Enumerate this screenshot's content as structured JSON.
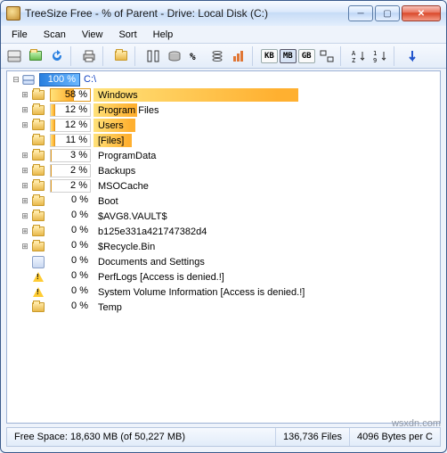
{
  "title": "TreeSize Free - % of Parent - Drive: Local Disk (C:)",
  "menus": [
    "File",
    "Scan",
    "View",
    "Sort",
    "Help"
  ],
  "toolbar": {
    "units": {
      "kb": "KB",
      "mb": "MB",
      "gb": "GB"
    }
  },
  "root": {
    "percent": "100 %",
    "path": "C:\\"
  },
  "rows": [
    {
      "pct": "58 %",
      "fill": 58,
      "name": "Windows",
      "ext": 230,
      "icon": "folder",
      "exp": "+"
    },
    {
      "pct": "12 %",
      "fill": 12,
      "name": "Program Files",
      "ext": 49,
      "icon": "folder",
      "exp": "+"
    },
    {
      "pct": "12 %",
      "fill": 12,
      "name": "Users",
      "ext": 47,
      "icon": "folder",
      "exp": "+"
    },
    {
      "pct": "11 %",
      "fill": 11,
      "name": "[Files]",
      "ext": 43,
      "icon": "folder",
      "exp": ""
    },
    {
      "pct": "3 %",
      "fill": 3,
      "name": "ProgramData",
      "ext": 0,
      "icon": "folder",
      "exp": "+"
    },
    {
      "pct": "2 %",
      "fill": 2,
      "name": "Backups",
      "ext": 0,
      "icon": "folder",
      "exp": "+"
    },
    {
      "pct": "2 %",
      "fill": 2,
      "name": "MSOCache",
      "ext": 0,
      "icon": "folder",
      "exp": "+"
    },
    {
      "pct": "0 %",
      "fill": 0,
      "name": "Boot",
      "ext": 0,
      "icon": "folder",
      "exp": "+"
    },
    {
      "pct": "0 %",
      "fill": 0,
      "name": "$AVG8.VAULT$",
      "ext": 0,
      "icon": "folder",
      "exp": "+"
    },
    {
      "pct": "0 %",
      "fill": 0,
      "name": "b125e331a421747382d4",
      "ext": 0,
      "icon": "folder",
      "exp": "+"
    },
    {
      "pct": "0 %",
      "fill": 0,
      "name": "$Recycle.Bin",
      "ext": 0,
      "icon": "folder",
      "exp": "+"
    },
    {
      "pct": "0 %",
      "fill": 0,
      "name": "Documents and Settings",
      "ext": 0,
      "icon": "special",
      "exp": ""
    },
    {
      "pct": "0 %",
      "fill": 0,
      "name": "PerfLogs  [Access is denied.!]",
      "ext": 0,
      "icon": "warn",
      "exp": ""
    },
    {
      "pct": "0 %",
      "fill": 0,
      "name": "System Volume Information  [Access is denied.!]",
      "ext": 0,
      "icon": "warn",
      "exp": ""
    },
    {
      "pct": "0 %",
      "fill": 0,
      "name": "Temp",
      "ext": 0,
      "icon": "folder",
      "exp": ""
    }
  ],
  "status": {
    "free": "Free Space: 18,630 MB  (of 50,227 MB)",
    "files": "136,736  Files",
    "cluster": "4096 Bytes per C"
  },
  "watermark": "wsxdn.com"
}
